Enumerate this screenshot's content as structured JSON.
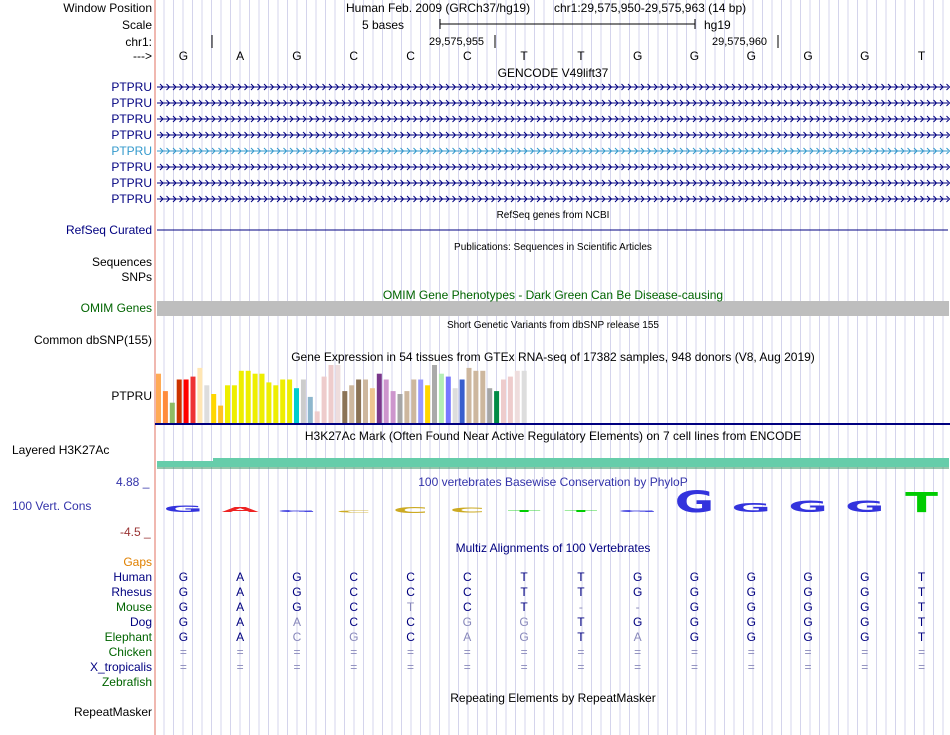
{
  "header": {
    "window_position_label": "Window Position",
    "assembly": "Human Feb. 2009 (GRCh37/hg19)",
    "position": "chr1:29,575,950-29,575,963 (14 bp)",
    "scale_label": "Scale",
    "scale_text": "5 bases",
    "scale_db": "hg19",
    "chrom_label": "chr1:",
    "tick_1": "29,575,955",
    "tick_2": "29,575,960",
    "strand_label": "--->"
  },
  "bases": [
    "G",
    "A",
    "G",
    "C",
    "C",
    "C",
    "T",
    "T",
    "G",
    "G",
    "G",
    "G",
    "G",
    "T"
  ],
  "gencode": {
    "title": "GENCODE V49lift37",
    "genes": [
      "PTPRU",
      "PTPRU",
      "PTPRU",
      "PTPRU",
      "PTPRU",
      "PTPRU",
      "PTPRU",
      "PTPRU"
    ],
    "highlight_index": 4
  },
  "refseq": {
    "title": "RefSeq genes from NCBI",
    "label": "RefSeq Curated"
  },
  "publications": {
    "title": "Publications: Sequences in Scientific Articles",
    "label_1": "Sequences",
    "label_2": "SNPs"
  },
  "omim": {
    "title": "OMIM Gene Phenotypes - Dark Green Can Be Disease-causing",
    "label": "OMIM Genes"
  },
  "dbsnp": {
    "title": "Short Genetic Variants from dbSNP release 155",
    "label": "Common dbSNP(155)"
  },
  "gtex": {
    "title": "Gene Expression in 54 tissues from GTEx RNA-seq of 17382 samples, 948 donors (V8, Aug 2019)",
    "label": "PTPRU",
    "levels": [
      0.85,
      0.55,
      0.35,
      0.75,
      0.75,
      0.8,
      0.95,
      0.65,
      0.5,
      0.3,
      0.65,
      0.65,
      0.9,
      0.9,
      0.85,
      0.85,
      0.7,
      0.65,
      0.75,
      0.75,
      0.6,
      0.75,
      0.45,
      0.2,
      0.8,
      1.0,
      1.0,
      0.55,
      0.65,
      0.75,
      0.75,
      0.6,
      0.85,
      0.75,
      0.55,
      0.5,
      0.55,
      0.75,
      0.75,
      0.65,
      1.0,
      0.85,
      0.8,
      0.6,
      0.75,
      0.95,
      0.9,
      0.9,
      0.6,
      0.55,
      0.75,
      0.8,
      0.9,
      0.9
    ],
    "colors": [
      "#FFAA55",
      "#FF8C3C",
      "#8FBC64",
      "#CC3300",
      "#FF0000",
      "#EE3333",
      "#FFE6B3",
      "#DDDDDD",
      "#FFD700",
      "#FFC125",
      "#EEEE00",
      "#EEEE00",
      "#EEEE00",
      "#EEEE00",
      "#EEEE00",
      "#EEEE00",
      "#EEEE00",
      "#EEEE00",
      "#EEEE00",
      "#EEEE00",
      "#00CDCD",
      "#CCCCCC",
      "#8DB6CD",
      "#EECCCC",
      "#EECCCC",
      "#EECCCC",
      "#EEDDDD",
      "#8B7355",
      "#CDB79E",
      "#8B7355",
      "#CDB79E",
      "#EEC591",
      "#7A378B",
      "#CD96CD",
      "#CD96CD",
      "#A6A6A6",
      "#CDB79E",
      "#CDB79E",
      "#9999FF",
      "#FFD700",
      "#AAAAAA",
      "#B4EEB4",
      "#7777FF",
      "#DDDDDD",
      "#3A5FCD",
      "#CDB79E",
      "#CDB79E",
      "#CDB79E",
      "#A6A6A6",
      "#008B45",
      "#EECCCC",
      "#EECCCC",
      "#EEDDDD",
      "#DDDDDD"
    ]
  },
  "h3k27ac": {
    "title": "H3K27Ac Mark (Often Found Near Active Regulatory Elements) on 7 cell lines from ENCODE",
    "label": "Layered H3K27Ac"
  },
  "conservation": {
    "title": "100 vertebrates Basewise Conservation by PhyloP",
    "label": "100 Vert. Cons",
    "ymax": "4.88 _",
    "ymin": "-4.5 _",
    "scores": [
      1.5,
      1.1,
      0.3,
      -0.1,
      -1.3,
      -1.2,
      0.5,
      0.5,
      0.3,
      4.88,
      2.0,
      2.6,
      2.6,
      4.6
    ]
  },
  "multiz": {
    "title": "Multiz Alignments of 100 Vertebrates",
    "gaps_label": "Gaps",
    "species": [
      {
        "name": "Human",
        "color": "#000080",
        "bases": [
          "G",
          "A",
          "G",
          "C",
          "C",
          "C",
          "T",
          "T",
          "G",
          "G",
          "G",
          "G",
          "G",
          "T"
        ]
      },
      {
        "name": "Rhesus",
        "color": "#000080",
        "bases": [
          "G",
          "A",
          "G",
          "C",
          "C",
          "C",
          "T",
          "T",
          "G",
          "G",
          "G",
          "G",
          "G",
          "T"
        ]
      },
      {
        "name": "Mouse",
        "color": "#006400",
        "bases": [
          "G",
          "A",
          "G",
          "C",
          "T",
          "C",
          "T",
          "-",
          "-",
          "G",
          "G",
          "G",
          "G",
          "T"
        ]
      },
      {
        "name": "Dog",
        "color": "#000080",
        "bases": [
          "G",
          "A",
          "A",
          "C",
          "C",
          "G",
          "G",
          "T",
          "G",
          "G",
          "G",
          "G",
          "G",
          "T"
        ]
      },
      {
        "name": "Elephant",
        "color": "#006400",
        "bases": [
          "G",
          "A",
          "C",
          "G",
          "C",
          "A",
          "G",
          "T",
          "A",
          "G",
          "G",
          "G",
          "G",
          "T"
        ]
      },
      {
        "name": "Chicken",
        "color": "#006400",
        "bases": [
          "=",
          "=",
          "=",
          "=",
          "=",
          "=",
          "=",
          "=",
          "=",
          "=",
          "=",
          "=",
          "=",
          "="
        ]
      },
      {
        "name": "X_tropicalis",
        "color": "#000080",
        "bases": [
          "=",
          "=",
          "=",
          "=",
          "=",
          "=",
          "=",
          "=",
          "=",
          "=",
          "=",
          "=",
          "=",
          "="
        ]
      },
      {
        "name": "Zebrafish",
        "color": "#006400",
        "bases": []
      }
    ]
  },
  "repeatmasker": {
    "title": "Repeating Elements by RepeatMasker",
    "label": "RepeatMasker"
  },
  "colors": {
    "label_blue": "#000080",
    "gtex_line": "#000080",
    "omim_bar": "#BEBEBE",
    "h3k27ac": "#66CDAA",
    "grid": "#B8B8D8",
    "cons_title": "#3333AA",
    "omim_title": "#006400"
  }
}
